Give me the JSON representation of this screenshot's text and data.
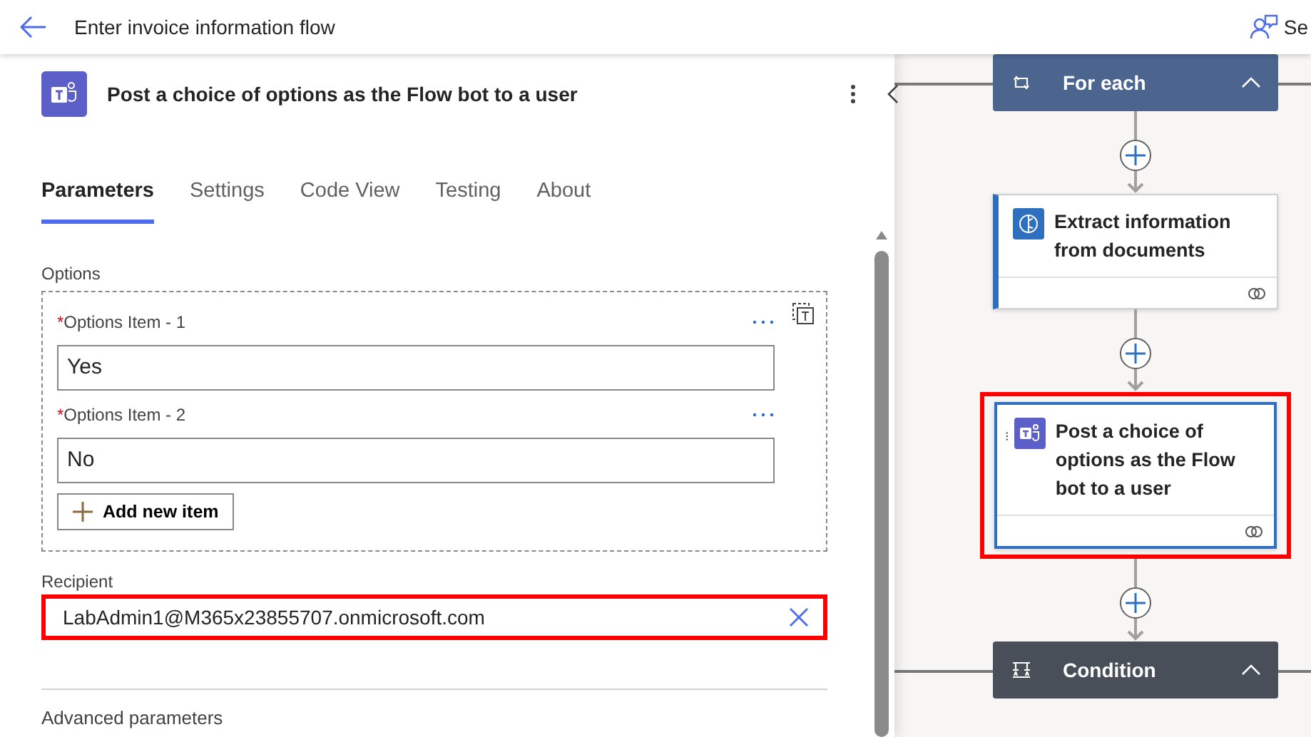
{
  "header": {
    "title": "Enter invoice information flow",
    "action": "Se"
  },
  "panel": {
    "title": "Post a choice of options as the Flow bot to a user",
    "tabs": [
      {
        "label": "Parameters",
        "selected": true
      },
      {
        "label": "Settings",
        "selected": false
      },
      {
        "label": "Code View",
        "selected": false
      },
      {
        "label": "Testing",
        "selected": false
      },
      {
        "label": "About",
        "selected": false
      }
    ],
    "options": {
      "label": "Options",
      "items": [
        {
          "label": "Options Item - 1",
          "required_mark": "*",
          "value": "Yes"
        },
        {
          "label": "Options Item - 2",
          "required_mark": "*",
          "value": "No"
        }
      ],
      "add_button": "Add new item"
    },
    "recipient": {
      "label": "Recipient",
      "value": "LabAdmin1@M365x23855707.onmicrosoft.com",
      "highlighted": true
    },
    "advanced": "Advanced parameters"
  },
  "canvas": {
    "nodes": [
      {
        "kind": "scope",
        "title": "For each",
        "color": "#4b658f",
        "expanded": true
      },
      {
        "kind": "action",
        "title": "Extract information from documents",
        "selected": false,
        "highlighted": false
      },
      {
        "kind": "action",
        "title": "Post a choice of options as the Flow bot to a user",
        "selected": true,
        "highlighted": true
      },
      {
        "kind": "scope",
        "title": "Condition",
        "color": "#484f58",
        "expanded": true
      }
    ]
  }
}
